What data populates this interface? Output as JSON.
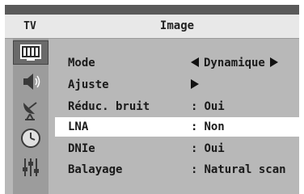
{
  "header": {
    "tv_label": "TV",
    "title": "Image"
  },
  "sidebar": {
    "icons": [
      {
        "name": "picture-icon",
        "active": true
      },
      {
        "name": "sound-icon",
        "active": false
      },
      {
        "name": "channel-antenna-icon",
        "active": false
      },
      {
        "name": "clock-icon",
        "active": false
      },
      {
        "name": "setup-sliders-icon",
        "active": false
      }
    ]
  },
  "menu": {
    "items": [
      {
        "label": "Mode",
        "separator": "",
        "value": "Dynamique",
        "has_left_arrow": true,
        "has_right_arrow": true,
        "selected": false
      },
      {
        "label": "Ajuste",
        "separator": "",
        "value": "",
        "has_left_arrow": false,
        "has_right_arrow": true,
        "selected": false
      },
      {
        "label": "Réduc. bruit",
        "separator": ":",
        "value": "Oui",
        "has_left_arrow": false,
        "has_right_arrow": false,
        "selected": false
      },
      {
        "label": "LNA",
        "separator": ":",
        "value": "Non",
        "has_left_arrow": false,
        "has_right_arrow": false,
        "selected": true
      },
      {
        "label": "DNIe",
        "separator": ":",
        "value": "Oui",
        "has_left_arrow": false,
        "has_right_arrow": false,
        "selected": false
      },
      {
        "label": "Balayage",
        "separator": ":",
        "value": "Natural scan",
        "has_left_arrow": false,
        "has_right_arrow": false,
        "selected": false
      }
    ]
  },
  "colors": {
    "frame": "#b8b8b8",
    "header_bg": "#e8e8e8",
    "selected_row": "#ffffff",
    "sidebar_bg": "#9c9c9c",
    "active_icon_bg": "#6a6a6a"
  }
}
